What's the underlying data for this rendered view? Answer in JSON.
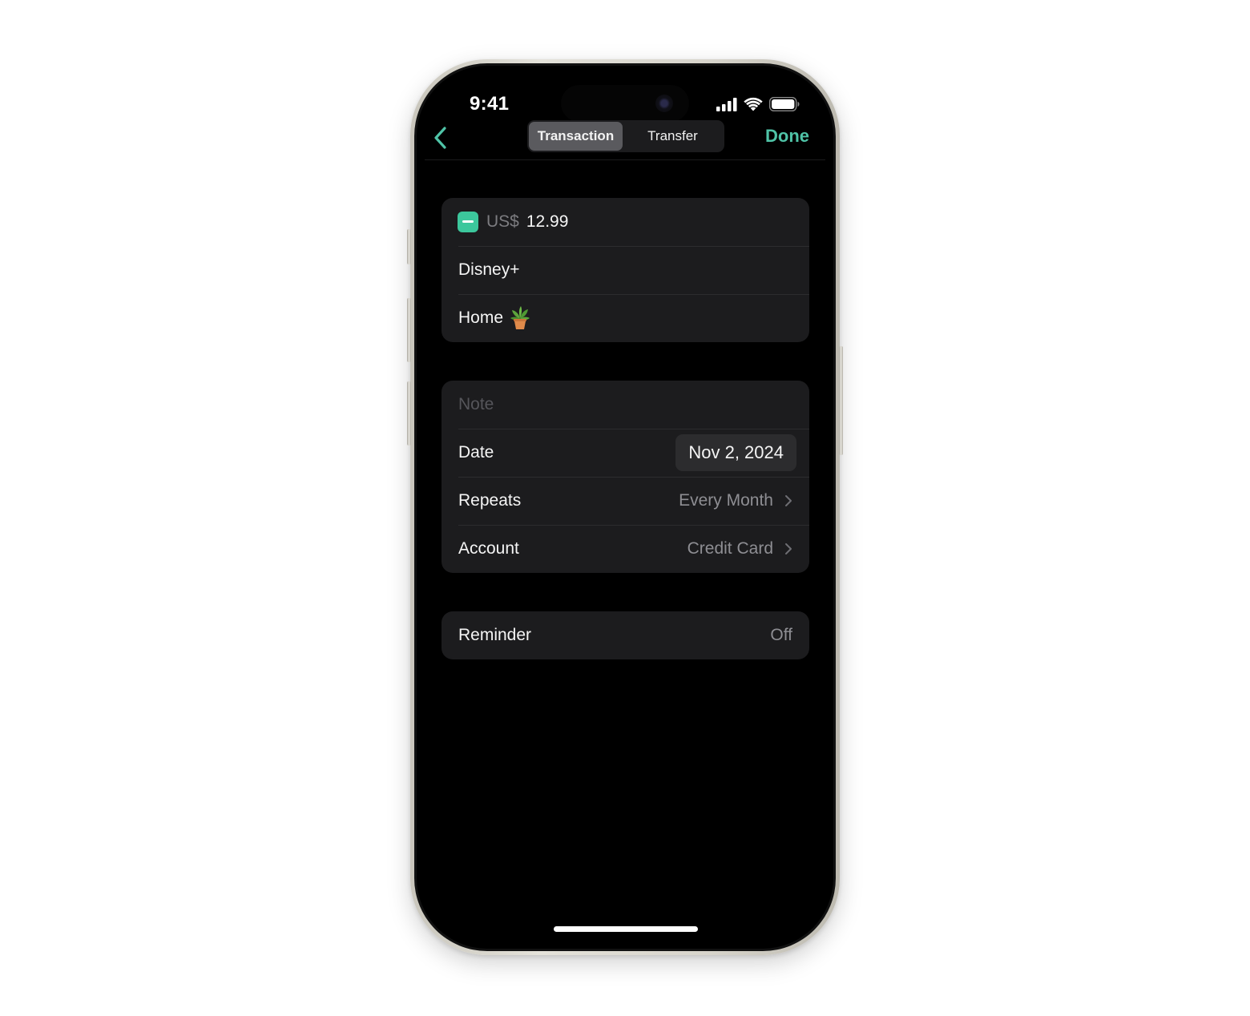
{
  "status_bar": {
    "time": "9:41",
    "icons": [
      "cellular-signal-icon",
      "wifi-icon",
      "battery-icon"
    ]
  },
  "nav": {
    "back_icon": "chevron-left-icon",
    "segments": [
      {
        "label": "Transaction",
        "selected": true
      },
      {
        "label": "Transfer",
        "selected": false
      }
    ],
    "done_label": "Done",
    "accent_color": "#4fc3a7"
  },
  "transaction": {
    "type_icon": "minus-badge-icon",
    "type_color": "#3cc79c",
    "currency": "US$",
    "amount": "12.99",
    "payee": "Disney+",
    "category": "Home",
    "category_emoji": "potted-plant-icon"
  },
  "details": {
    "note_placeholder": "Note",
    "date_label": "Date",
    "date_value": "Nov 2, 2024",
    "repeats_label": "Repeats",
    "repeats_value": "Every Month",
    "account_label": "Account",
    "account_value": "Credit Card"
  },
  "reminder": {
    "label": "Reminder",
    "value": "Off"
  }
}
